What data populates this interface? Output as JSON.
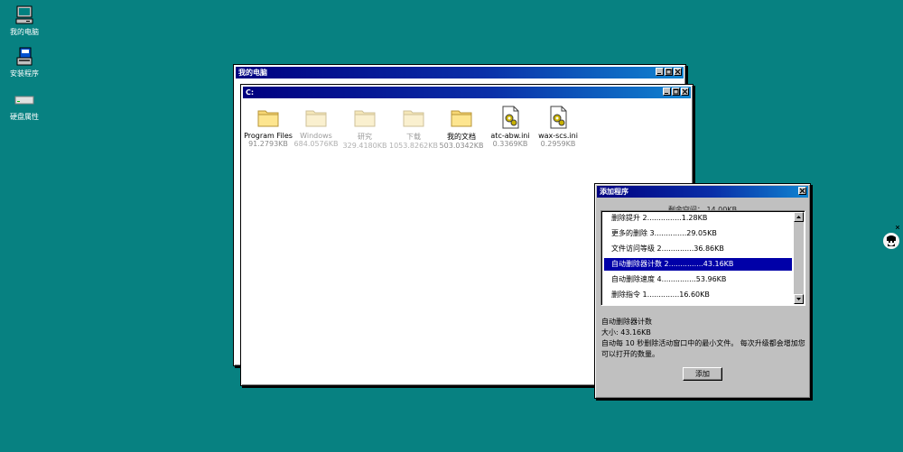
{
  "desktop": {
    "icons": [
      {
        "label": "我的电脑",
        "icon": "computer-icon"
      },
      {
        "label": "安装程序",
        "icon": "installer-icon"
      },
      {
        "label": "硬盘属性",
        "icon": "hard-drive-icon"
      }
    ]
  },
  "window_mycomputer": {
    "title": "我的电脑"
  },
  "window_c": {
    "title": "C:",
    "files": [
      {
        "name": "Program Files",
        "size": "91.2793KB",
        "icon": "folder-icon",
        "dim": false
      },
      {
        "name": "Windows",
        "size": "684.0576KB",
        "icon": "folder-icon",
        "dim": true
      },
      {
        "name": "研究",
        "size": "329.4180KB",
        "icon": "folder-icon",
        "dim": true
      },
      {
        "name": "下载",
        "size": "1053.8262KB",
        "icon": "folder-icon",
        "dim": true
      },
      {
        "name": "我的文档",
        "size": "503.0342KB",
        "icon": "folder-icon",
        "dim": false
      },
      {
        "name": "atc-abw.ini",
        "size": "0.3369KB",
        "icon": "ini-file-icon",
        "dim": false
      },
      {
        "name": "wax-scs.ini",
        "size": "0.2959KB",
        "icon": "ini-file-icon",
        "dim": false
      }
    ]
  },
  "dialog": {
    "title": "添加程序",
    "free_space": "剩余空间： 14.00KB",
    "items": [
      {
        "label": "删除提升 2...............1.28KB",
        "selected": false
      },
      {
        "label": "更多的删除 3..............29.05KB",
        "selected": false
      },
      {
        "label": "文件访问等级 2..............36.86KB",
        "selected": false
      },
      {
        "label": "自动删除器计数 2...............43.16KB",
        "selected": true
      },
      {
        "label": "自动删除速度 4...............53.96KB",
        "selected": false
      },
      {
        "label": "删除指令 1..............16.60KB",
        "selected": false
      }
    ],
    "desc_title": "自动删除器计数",
    "desc_size": "大小:   43.16KB",
    "desc_text": "自动每 10 秒删除活动窗口中的最小文件。 每次升级都会增加您可以打开的数量。",
    "add_button": "添加"
  },
  "colors": {
    "desktop": "#078181",
    "titlebar": "#000080",
    "selection": "#0000a8"
  }
}
